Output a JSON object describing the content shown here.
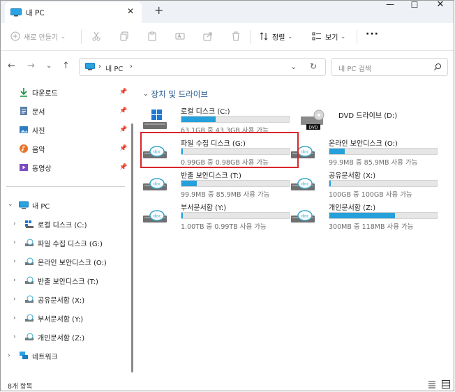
{
  "window": {
    "tab_title": "내 PC",
    "new_tab_icon": "plus-icon",
    "controls": {
      "minimize": "—",
      "maximize": "☐",
      "close": "✕"
    }
  },
  "toolbar": {
    "new_label": "새로 만들기",
    "sort_label": "정렬",
    "view_label": "보기",
    "more_label": "···"
  },
  "address": {
    "crumbs": [
      "내 PC"
    ],
    "search_placeholder": "내 PC 검색"
  },
  "sidebar": {
    "quick_access": [
      {
        "label": "다운로드",
        "icon": "download-icon"
      },
      {
        "label": "문서",
        "icon": "document-icon"
      },
      {
        "label": "사진",
        "icon": "pictures-icon"
      },
      {
        "label": "음악",
        "icon": "music-icon"
      },
      {
        "label": "동영상",
        "icon": "video-icon"
      }
    ],
    "this_pc": "내 PC",
    "drives": [
      "로컬 디스크 (C:)",
      "파일 수집 디스크 (G:)",
      "온라인 보안디스크 (O:)",
      "반출 보안디스크 (T:)",
      "공유문서함 (X:)",
      "부서문서함 (Y:)",
      "개인문서함 (Z:)"
    ],
    "network": "네트워크"
  },
  "main": {
    "group_title": "장치 및 드라이브",
    "drives": [
      {
        "name": "로컬 디스크 (C:)",
        "free": "63.1GB 중 43.3GB 사용 가능",
        "used_fraction": 0.32,
        "icon": "windows-drive-icon"
      },
      {
        "name": "DVD 드라이브 (D:)",
        "free": "",
        "used_fraction": null,
        "icon": "dvd-drive-icon",
        "badge": "DVD"
      },
      {
        "name": "파일 수집 디스크 (G:)",
        "free": "0.99GB 중 0.98GB 사용 가능",
        "used_fraction": 0.01,
        "icon": "doc-drive-icon"
      },
      {
        "name": "온라인 보안디스크 (O:)",
        "free": "99.9MB 중 85.9MB 사용 가능",
        "used_fraction": 0.14,
        "icon": "doc-drive-icon"
      },
      {
        "name": "반출 보안디스크 (T:)",
        "free": "99.9MB 중 85.9MB 사용 가능",
        "used_fraction": 0.14,
        "icon": "doc-drive-icon"
      },
      {
        "name": "공유문서함 (X:)",
        "free": "100GB 중 100GB 사용 가능",
        "used_fraction": 0.0,
        "icon": "doc-drive-icon"
      },
      {
        "name": "부서문서함 (Y:)",
        "free": "1.00TB 중 0.99TB 사용 가능",
        "used_fraction": 0.01,
        "icon": "doc-drive-icon"
      },
      {
        "name": "개인문서함 (Z:)",
        "free": "300MB 중 118MB 사용 가능",
        "used_fraction": 0.61,
        "icon": "doc-drive-icon"
      }
    ],
    "doc_badge": "doc"
  },
  "status": {
    "item_count": "8개 항목"
  },
  "colors": {
    "accent": "#26a0da",
    "highlight": "#d9262c",
    "group_header": "#1a4f8a"
  }
}
